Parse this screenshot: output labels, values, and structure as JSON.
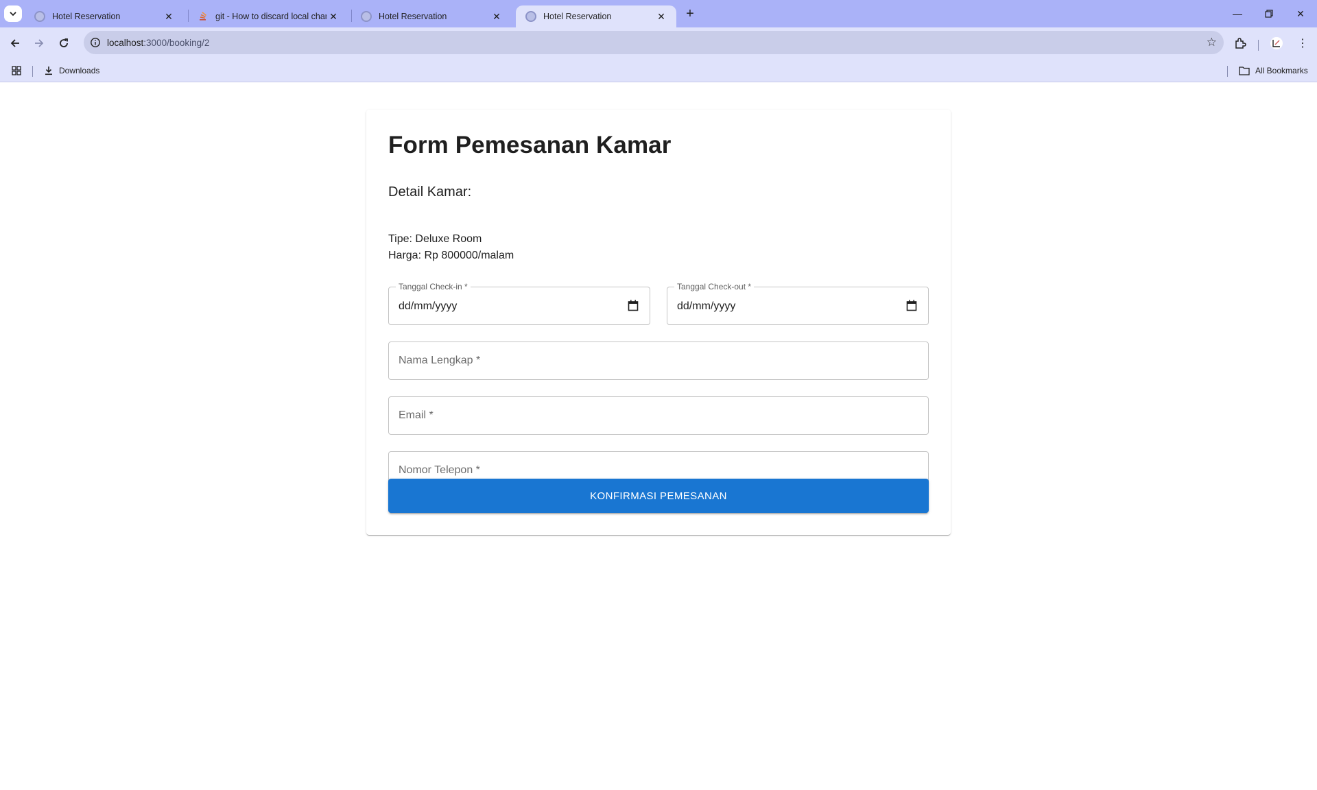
{
  "browser": {
    "tabs": [
      {
        "title": "Hotel Reservation",
        "favicon": "globe-icon",
        "active": false
      },
      {
        "title": "git - How to discard local chang",
        "favicon": "stackoverflow-icon",
        "active": false
      },
      {
        "title": "Hotel Reservation",
        "favicon": "globe-icon",
        "active": false
      },
      {
        "title": "Hotel Reservation",
        "favicon": "globe-icon",
        "active": true
      }
    ],
    "address": {
      "host": "localhost",
      "path": ":3000/booking/2"
    },
    "bookmarks": {
      "downloads": "Downloads",
      "all_bookmarks": "All Bookmarks"
    }
  },
  "form": {
    "title": "Form Pemesanan Kamar",
    "detail_heading": "Detail Kamar:",
    "room_type": "Tipe: Deluxe Room",
    "room_price": "Harga: Rp 800000/malam",
    "checkin": {
      "label": "Tanggal Check-in *",
      "value": "dd/mm/yyyy"
    },
    "checkout": {
      "label": "Tanggal Check-out *",
      "value": "dd/mm/yyyy"
    },
    "name": {
      "placeholder": "Nama Lengkap *"
    },
    "email": {
      "placeholder": "Email *"
    },
    "phone": {
      "placeholder": "Nomor Telepon *"
    },
    "submit_label": "KONFIRMASI PEMESANAN"
  },
  "colors": {
    "tabstrip": "#aab2f8",
    "toolbar": "#dfe2fb",
    "primary_button": "#1976d2"
  }
}
